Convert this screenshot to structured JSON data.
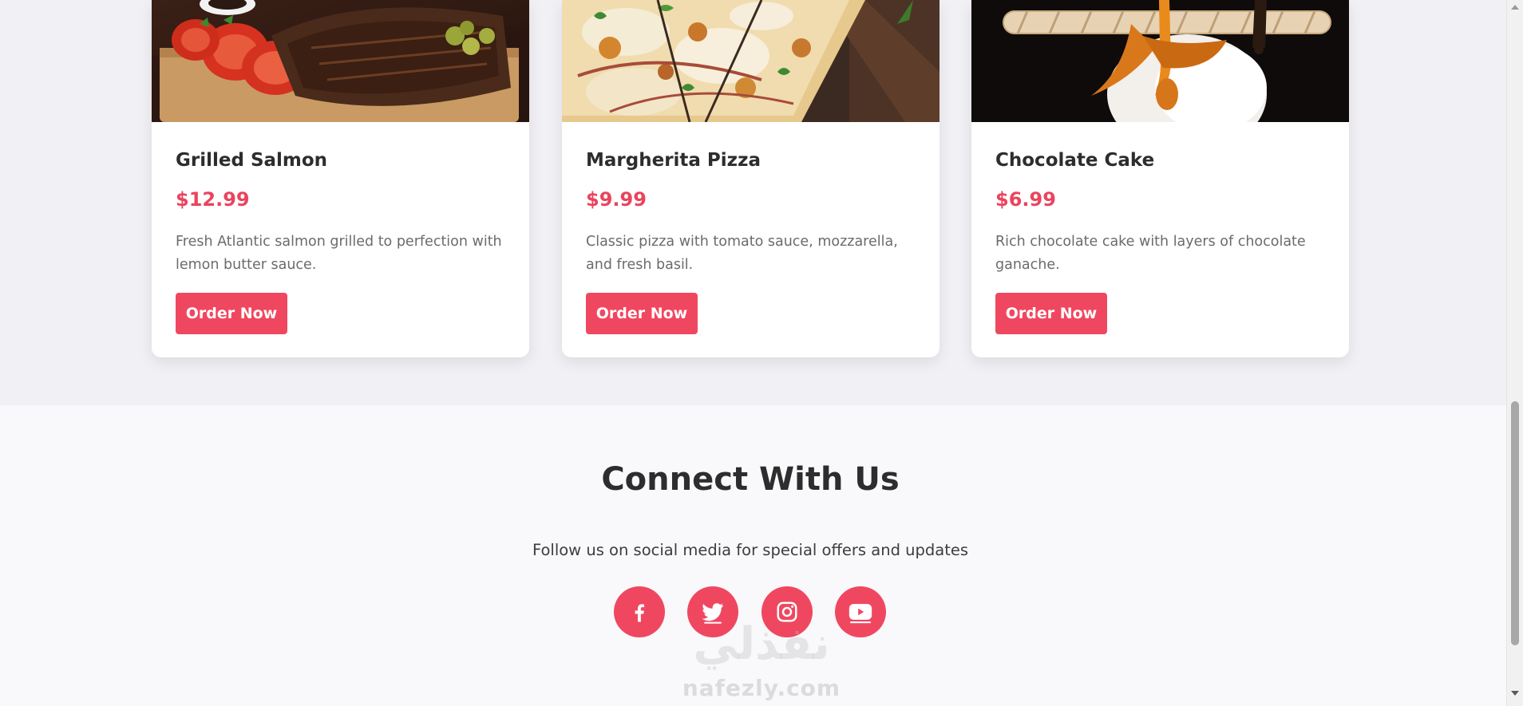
{
  "menu": {
    "items": [
      {
        "name": "Grilled Salmon",
        "price": "$12.99",
        "description": "Fresh Atlantic salmon grilled to perfection with lemon butter sauce.",
        "button": "Order Now"
      },
      {
        "name": "Margherita Pizza",
        "price": "$9.99",
        "description": "Classic pizza with tomato sauce, mozzarella, and fresh basil.",
        "button": "Order Now"
      },
      {
        "name": "Chocolate Cake",
        "price": "$6.99",
        "description": "Rich chocolate cake with layers of chocolate ganache.",
        "button": "Order Now"
      }
    ]
  },
  "connect": {
    "title": "Connect With Us",
    "subtitle": "Follow us on social media for special offers and updates",
    "social": [
      {
        "icon": "facebook-icon"
      },
      {
        "icon": "twitter-icon"
      },
      {
        "icon": "instagram-icon"
      },
      {
        "icon": "youtube-icon"
      }
    ]
  },
  "watermark": {
    "arabic": "نفذلي",
    "latin": "nafezly.com"
  },
  "colors": {
    "accent": "#f04760",
    "price": "#e9455e",
    "page_bg": "#f1f0f4",
    "connect_bg": "#f9f8fa"
  }
}
